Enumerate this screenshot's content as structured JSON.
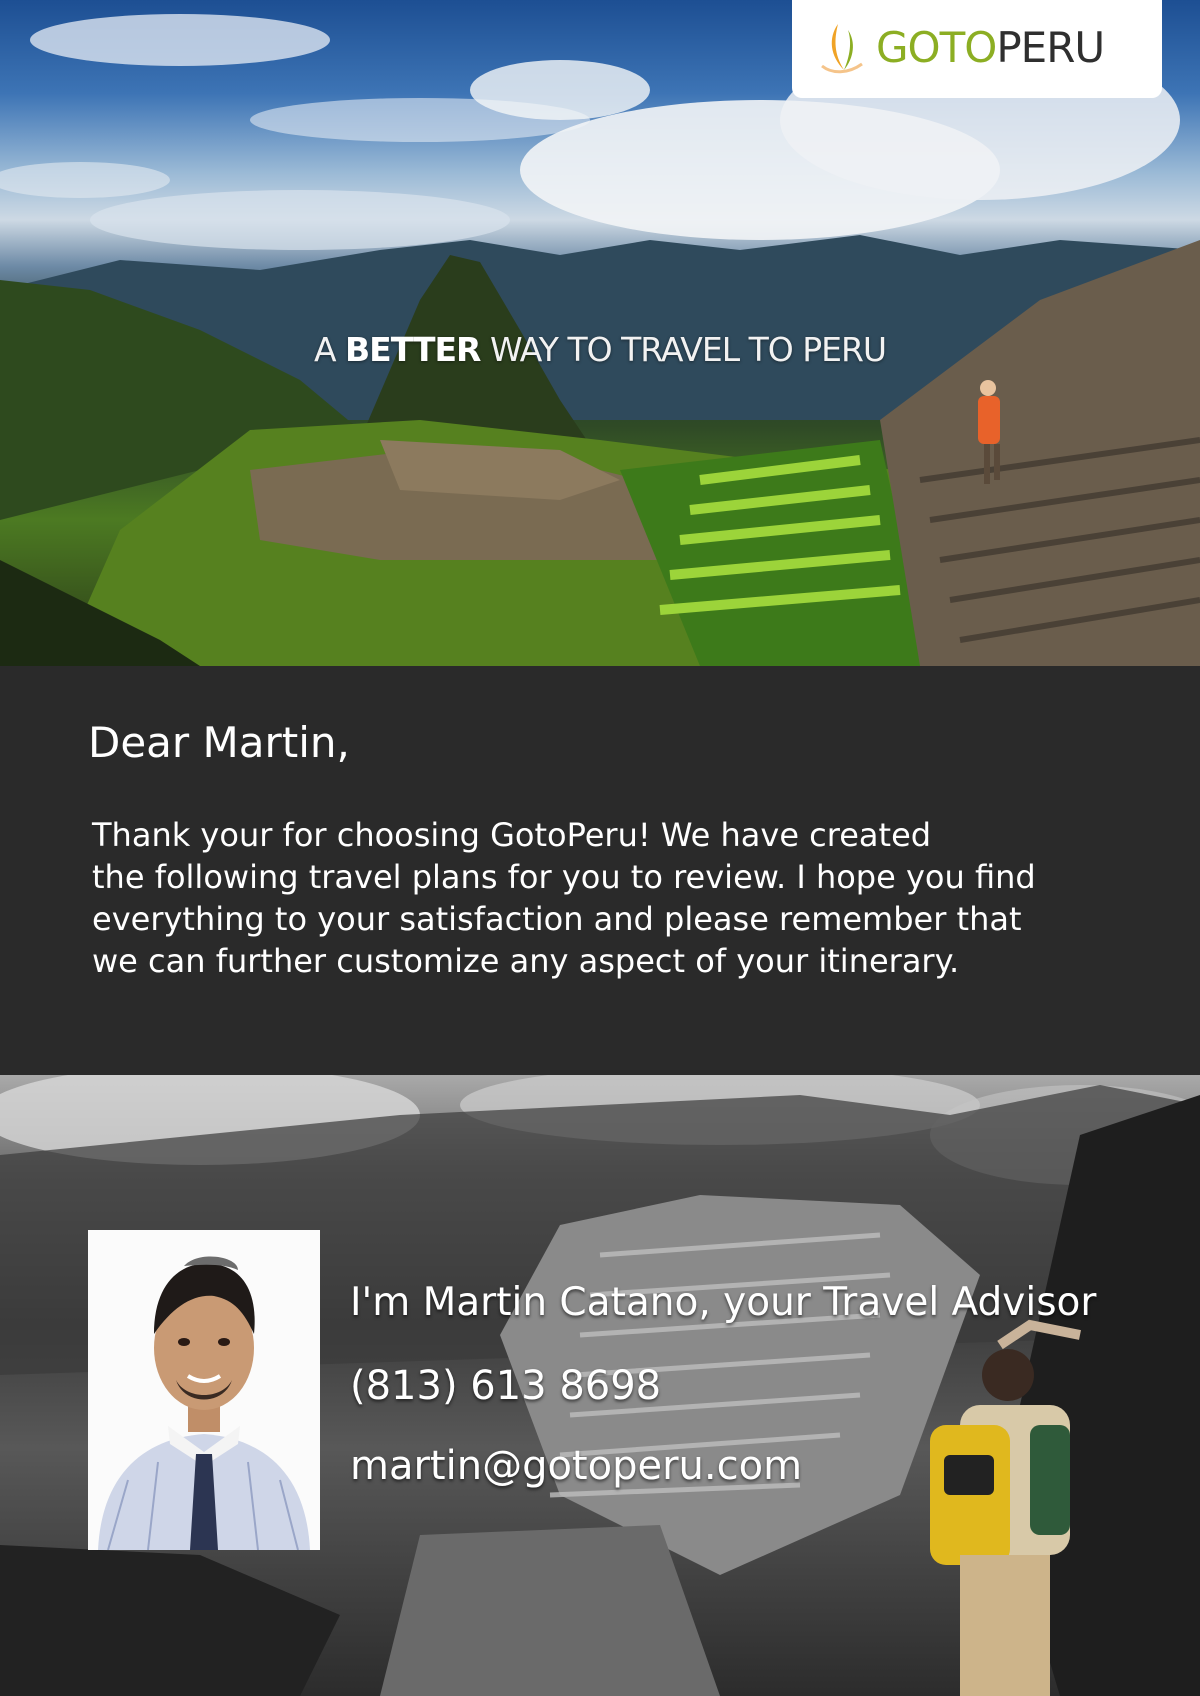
{
  "brand": {
    "logo_part1": "GOTO",
    "logo_part2": "PERU",
    "logo_alt": "GOTOPERU"
  },
  "hero": {
    "tagline_pre": "A ",
    "tagline_bold": "BETTER",
    "tagline_post": " WAY TO TRAVEL TO PERU"
  },
  "letter": {
    "greeting": "Dear Martin,",
    "body_lines": [
      "Thank your for choosing GotoPeru! We have created",
      "the following travel plans for you to review. I hope you find",
      "everything to your satisfaction and please remember that",
      "we can further customize any aspect of your itinerary."
    ]
  },
  "advisor": {
    "intro": "I'm Martin Catano, your Travel Advisor",
    "phone": "(813) 613 8698",
    "email": "martin@gotoperu.com"
  },
  "colors": {
    "logo_green": "#8cae23",
    "logo_orange": "#f0a326",
    "logo_dark": "#2f2f2f",
    "letter_bg": "#2a2a2a"
  }
}
